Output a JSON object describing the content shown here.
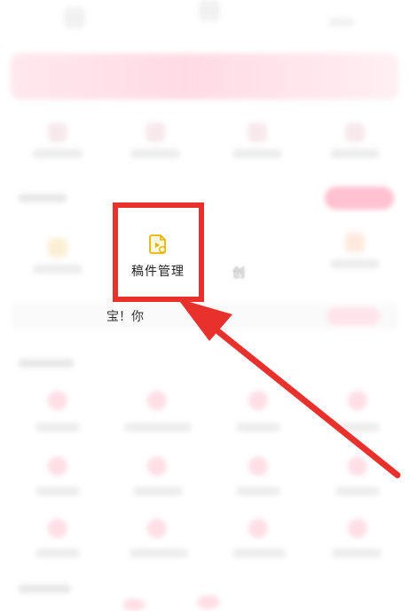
{
  "focus_item": {
    "label": "稿件管理",
    "icon": "document-icon"
  },
  "neighbor_item": {
    "label_partial": "创"
  },
  "notice": {
    "text": "宝！你"
  },
  "colors": {
    "highlight": "#e8312d",
    "arrow": "#e8312d",
    "icon": "#e8b400"
  }
}
